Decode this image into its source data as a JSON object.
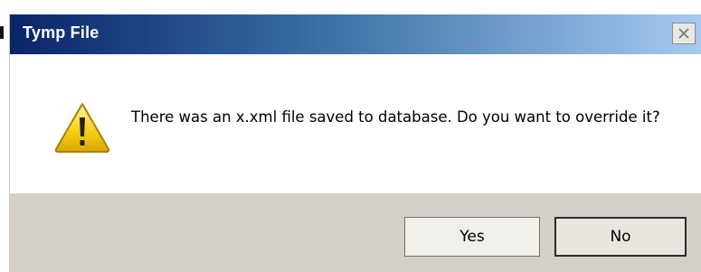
{
  "dialog": {
    "title": "Tymp File",
    "close_icon": "close-icon",
    "message": "There was an x.xml file saved to database. Do you want to override it?",
    "icon": "warning-icon",
    "buttons": {
      "yes_label": "Yes",
      "no_label": "No"
    }
  },
  "colors": {
    "titlebar_start": "#0a246a",
    "titlebar_end": "#a6caf0",
    "dialog_background": "#d4d0c8",
    "content_background": "#ffffff",
    "warning_yellow": "#f2c400"
  }
}
